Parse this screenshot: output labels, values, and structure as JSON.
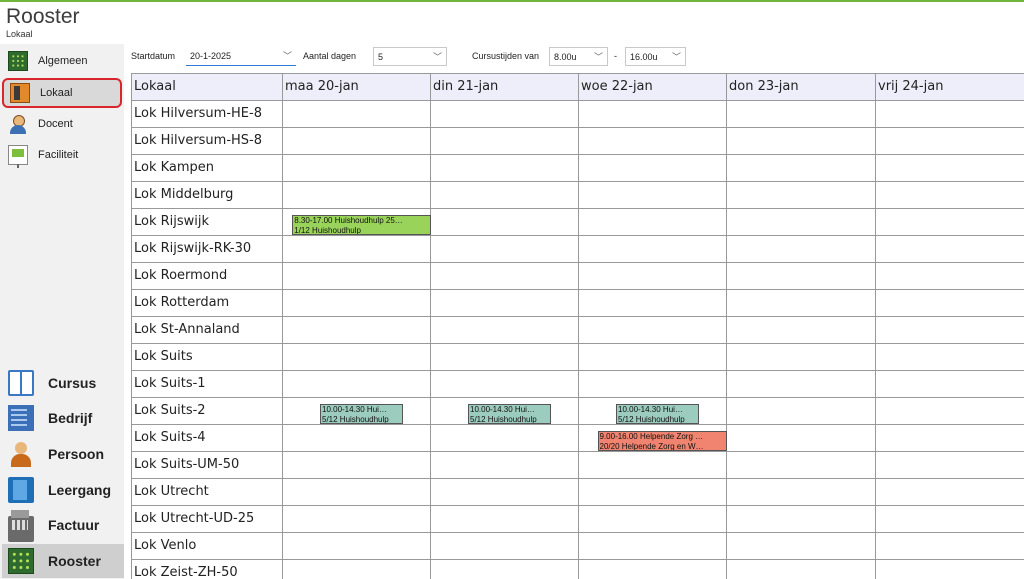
{
  "app": {
    "title": "Rooster",
    "subtitle": "Lokaal"
  },
  "colors": {
    "accent_line": "#6fb53e",
    "event_green": "#99d35a",
    "event_teal": "#9cccbd",
    "event_red": "#f08470",
    "header_bg": "#eeeefa",
    "active_outline": "#d9262c"
  },
  "sidebar": {
    "top_items": [
      {
        "label": "Algemeen",
        "icon": "grid-icon",
        "active": false
      },
      {
        "label": "Lokaal",
        "icon": "door-icon",
        "active": true
      },
      {
        "label": "Docent",
        "icon": "teacher-icon",
        "active": false
      },
      {
        "label": "Faciliteit",
        "icon": "presentation-board-icon",
        "active": false
      }
    ],
    "bottom_items": [
      {
        "label": "Cursus",
        "icon": "book-icon",
        "active": false
      },
      {
        "label": "Bedrijf",
        "icon": "building-icon",
        "active": false
      },
      {
        "label": "Persoon",
        "icon": "person-icon",
        "active": false
      },
      {
        "label": "Leergang",
        "icon": "folder-icon",
        "active": false
      },
      {
        "label": "Factuur",
        "icon": "cash-register-icon",
        "active": false
      },
      {
        "label": "Rooster",
        "icon": "grid-icon",
        "active": true
      }
    ]
  },
  "toolbar": {
    "startdatum_label": "Startdatum",
    "startdatum_value": "20-1-2025",
    "aantal_dagen_label": "Aantal dagen",
    "aantal_dagen_value": "5",
    "cursustijden_label": "Cursustijden van",
    "time_from": "8.00u",
    "time_separator": "-",
    "time_to": "16.00u"
  },
  "schedule": {
    "room_header": "Lokaal",
    "days": [
      "maa 20-jan",
      "din 21-jan",
      "woe 22-jan",
      "don 23-jan",
      "vrij 24-jan"
    ],
    "rooms": [
      "Lok Hilversum-HE-8",
      "Lok Hilversum-HS-8",
      "Lok Kampen",
      "Lok Middelburg",
      "Lok Rijswijk",
      "Lok Rijswijk-RK-30",
      "Lok Roermond",
      "Lok Rotterdam",
      "Lok St-Annaland",
      "Lok Suits",
      "Lok Suits-1",
      "Lok Suits-2",
      "Lok Suits-4",
      "Lok Suits-UM-50",
      "Lok Utrecht",
      "Lok Utrecht-UD-25",
      "Lok Venlo",
      "Lok Zeist-ZH-50"
    ],
    "events": [
      {
        "room": 4,
        "day": 0,
        "start": 8.5,
        "end": 17.0,
        "color": "#99d35a",
        "line1": "8.30-17.00 Huishoudhulp 25…",
        "line2": "1/12 Huishoudhulp"
      },
      {
        "room": 11,
        "day": 0,
        "start": 10.0,
        "end": 14.5,
        "color": "#9cccbd",
        "line1": "10.00-14.30 Hui…",
        "line2": "5/12 Huishoudhulp"
      },
      {
        "room": 11,
        "day": 1,
        "start": 10.0,
        "end": 14.5,
        "color": "#9cccbd",
        "line1": "10.00-14.30 Hui…",
        "line2": "5/12 Huishoudhulp"
      },
      {
        "room": 11,
        "day": 2,
        "start": 10.0,
        "end": 14.5,
        "color": "#9cccbd",
        "line1": "10.00-14.30 Hui…",
        "line2": "5/12 Huishoudhulp"
      },
      {
        "room": 12,
        "day": 2,
        "start": 9.0,
        "end": 16.0,
        "color": "#f08470",
        "line1": "9.00-16.00 Helpende Zorg …",
        "line2": "20/20 Helpende Zorg en W…"
      }
    ]
  }
}
